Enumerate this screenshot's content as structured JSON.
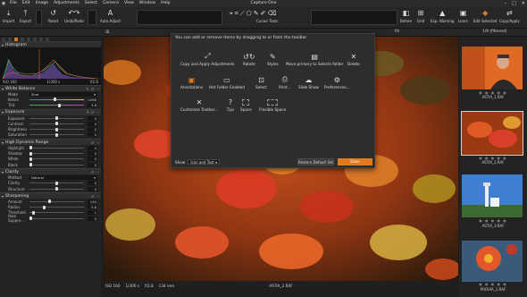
{
  "app": {
    "title": "Capture One"
  },
  "menu": [
    "File",
    "Edit",
    "Image",
    "Adjustments",
    "Select",
    "Camera",
    "View",
    "Window",
    "Help"
  ],
  "toolbar": {
    "import": "Import",
    "export": "Export",
    "reset": "Reset",
    "undo_redo": "Undo/Redo",
    "auto_adjust": "Auto Adjust",
    "cursor_tools": "Cursor Tools",
    "before": "Before",
    "grid": "Grid",
    "exp_warning": "Exp. Warning",
    "learn": "Learn",
    "edit_selected": "Edit Selected",
    "copy_apply": "Copy/Apply"
  },
  "subbar": {
    "fit": "Fit",
    "filtered": "1/9 (filtered)"
  },
  "histogram": {
    "title": "Histogram",
    "iso": "ISO 160",
    "shutter": "1/300 s",
    "aperture": "f/2.8"
  },
  "white_balance": {
    "title": "White Balance",
    "mode_label": "Mode",
    "mode_value": "Shot",
    "kelvin_label": "Kelvin",
    "kelvin_value": "4498",
    "tint_label": "Tint",
    "tint_value": "3.8"
  },
  "exposure": {
    "title": "Exposure",
    "rows": [
      {
        "label": "Exposure",
        "value": "0"
      },
      {
        "label": "Contrast",
        "value": "0"
      },
      {
        "label": "Brightness",
        "value": "0"
      },
      {
        "label": "Saturation",
        "value": "0"
      }
    ]
  },
  "hdr": {
    "title": "High Dynamic Range",
    "rows": [
      {
        "label": "Highlight",
        "value": "0"
      },
      {
        "label": "Shadow",
        "value": "0"
      },
      {
        "label": "White",
        "value": "0"
      },
      {
        "label": "Black",
        "value": "0"
      }
    ]
  },
  "clarity": {
    "title": "Clarity",
    "method_label": "Method",
    "method_value": "Natural",
    "rows": [
      {
        "label": "Clarity",
        "value": "0"
      },
      {
        "label": "Structure",
        "value": "0"
      }
    ]
  },
  "sharpening": {
    "title": "Sharpening",
    "rows": [
      {
        "label": "Amount",
        "value": "140"
      },
      {
        "label": "Radius",
        "value": "0.8"
      },
      {
        "label": "Threshold",
        "value": "1"
      },
      {
        "label": "Halo Suppre...",
        "value": "0"
      }
    ]
  },
  "viewer": {
    "iso": "ISO 160",
    "shutter": "1/300 s",
    "aperture": "f/2.8",
    "focal": "134 mm",
    "filename": "ASTIA_2.RAF"
  },
  "thumbnails": [
    {
      "label": "ASTIA_1.RAF"
    },
    {
      "label": "ASTIA_2.RAF"
    },
    {
      "label": "ASTIA_3.RAF"
    },
    {
      "label": "PROVIA_1.RAF"
    }
  ],
  "dialog": {
    "header": "You can add or remove items by dragging to or from the toolbar",
    "items": [
      {
        "label": "Copy and Apply Adjustments",
        "icon": "copy-apply-icon"
      },
      {
        "label": "Rotate",
        "icon": "rotate-icon"
      },
      {
        "label": "Styles",
        "icon": "styles-icon"
      },
      {
        "label": "Move primary to Selects folder",
        "icon": "move-selects-icon"
      },
      {
        "label": "Delete",
        "icon": "delete-icon"
      },
      {
        "label": "Annotations",
        "icon": "annotations-icon"
      },
      {
        "label": "Hot Folder Enabled",
        "icon": "hot-folder-icon"
      },
      {
        "label": "Select",
        "icon": "select-icon"
      },
      {
        "label": "Print...",
        "icon": "print-icon"
      },
      {
        "label": "Slide Show",
        "icon": "slideshow-icon"
      },
      {
        "label": "Preferences...",
        "icon": "preferences-icon"
      },
      {
        "label": "Customize Toolbar...",
        "icon": "customize-icon"
      },
      {
        "label": "Tips",
        "icon": "tips-icon"
      },
      {
        "label": "Space",
        "icon": "space-icon"
      },
      {
        "label": "Flexible Space",
        "icon": "flexible-space-icon"
      }
    ],
    "show_label": "Show",
    "show_value": "Icon and Text",
    "restore": "Restore Default Set",
    "done": "Done"
  },
  "colors": {
    "accent": "#e07a1a"
  }
}
